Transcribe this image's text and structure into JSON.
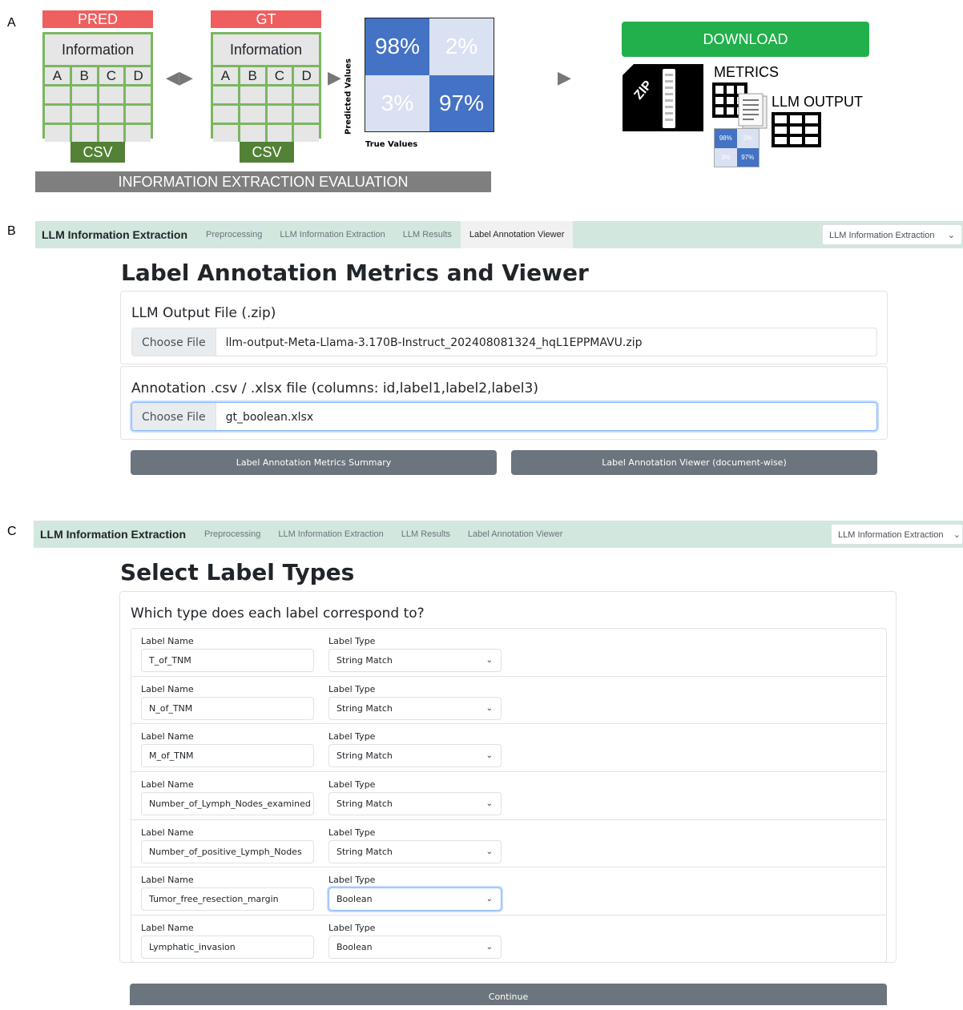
{
  "panels": {
    "a": "A",
    "b": "B",
    "c": "C"
  },
  "panelA": {
    "pred_label": "PRED",
    "gt_label": "GT",
    "info_label": "Information",
    "columns": [
      "A",
      "B",
      "C",
      "D"
    ],
    "csv_label": "CSV",
    "confusion": {
      "tl": "98%",
      "tr": "2%",
      "bl": "3%",
      "br": "97%",
      "ylabel": "Predicted Values",
      "xlabel": "True Values"
    },
    "eval_label": "INFORMATION EXTRACTION EVALUATION",
    "download_label": "DOWNLOAD",
    "zip_label": "ZIP",
    "metrics_label": "METRICS",
    "llm_output_label": "LLM OUTPUT",
    "mini": {
      "tl": "98%",
      "tr": "2%",
      "bl": "3%",
      "br": "97%"
    }
  },
  "navbar": {
    "brand": "LLM Information Extraction",
    "items": [
      "Preprocessing",
      "LLM Information Extraction",
      "LLM Results",
      "Label Annotation Viewer"
    ],
    "dropdown": "LLM Information Extraction"
  },
  "panelB": {
    "title": "Label Annotation Metrics and Viewer",
    "llm_file_label": "LLM Output File (.zip)",
    "choose_file": "Choose File",
    "llm_file_name": "llm-output-Meta-Llama-3.170B-Instruct_202408081324_hqL1EPPMAVU.zip",
    "annotation_label": "Annotation .csv / .xlsx file (columns: id,label1,label2,label3)",
    "annotation_file_name": "gt_boolean.xlsx",
    "metrics_button": "Label Annotation Metrics Summary",
    "viewer_button": "Label Annotation Viewer (document-wise)"
  },
  "panelC": {
    "title": "Select Label Types",
    "question": "Which type does each label correspond to?",
    "name_header": "Label Name",
    "type_header": "Label Type",
    "rows": [
      {
        "name": "T_of_TNM",
        "type": "String Match"
      },
      {
        "name": "N_of_TNM",
        "type": "String Match"
      },
      {
        "name": "M_of_TNM",
        "type": "String Match"
      },
      {
        "name": "Number_of_Lymph_Nodes_examined",
        "type": "String Match"
      },
      {
        "name": "Number_of_positive_Lymph_Nodes",
        "type": "String Match"
      },
      {
        "name": "Tumor_free_resection_margin",
        "type": "Boolean"
      },
      {
        "name": "Lymphatic_invasion",
        "type": "Boolean"
      }
    ],
    "continue_button": "Continue"
  },
  "colors": {
    "red": "#ef5f5f",
    "green": "#7bb661",
    "dark_green": "#538135",
    "download": "#21b04b",
    "blue": "#4472c4",
    "navbar": "#d2e7dd",
    "button_gray": "#6c757d"
  }
}
